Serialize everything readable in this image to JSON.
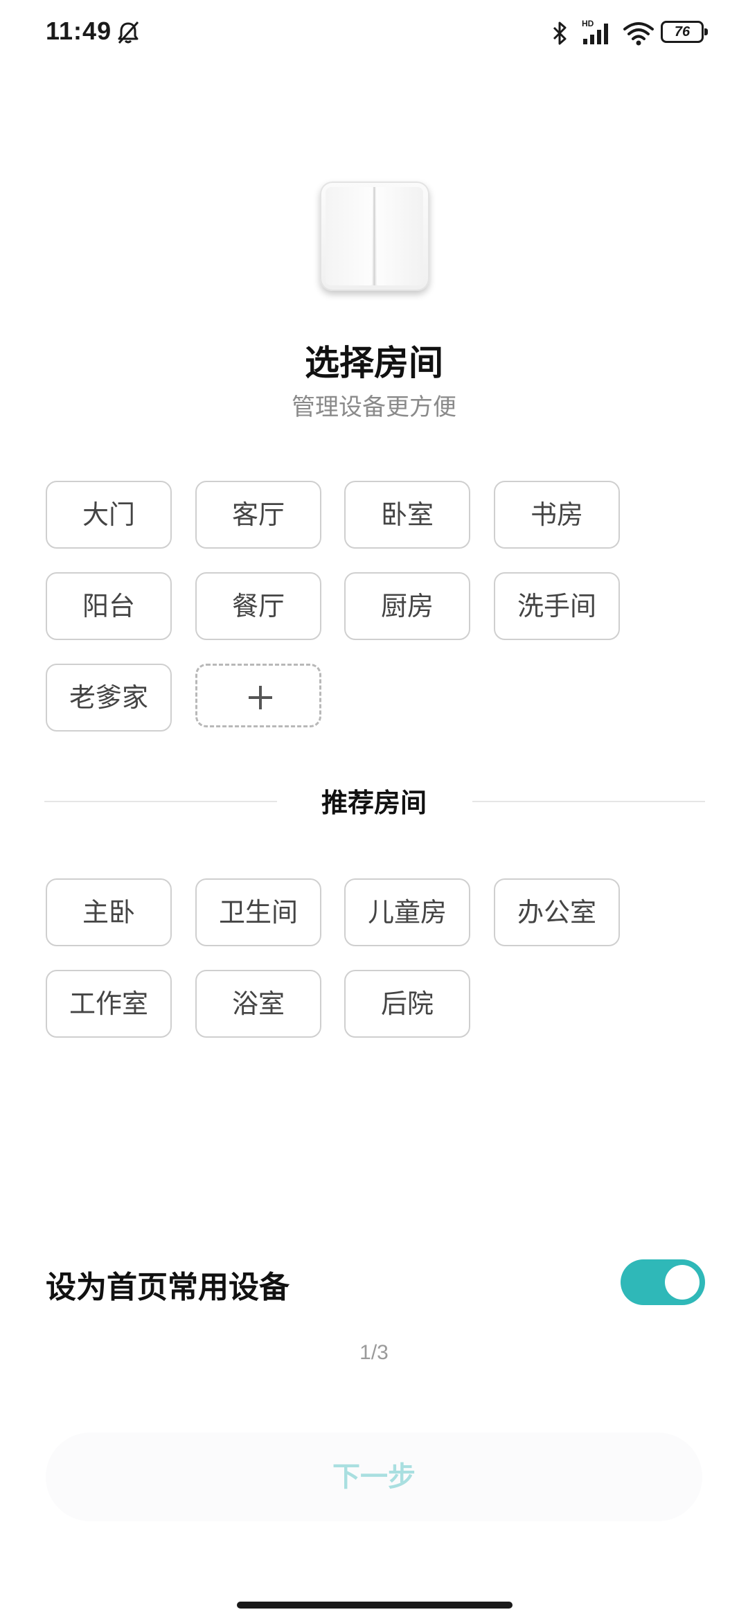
{
  "status_bar": {
    "time": "11:49",
    "network_badge": "HD",
    "battery_level": "76",
    "icons": [
      "bell-off-icon",
      "bluetooth-icon",
      "signal-icon",
      "wifi-icon",
      "battery-icon"
    ]
  },
  "header": {
    "device_icon": "double-rocker-switch-icon",
    "title": "选择房间",
    "subtitle": "管理设备更方便"
  },
  "rooms": {
    "items": [
      "大门",
      "客厅",
      "卧室",
      "书房",
      "阳台",
      "餐厅",
      "厨房",
      "洗手间",
      "老爹家"
    ],
    "add_icon": "plus-icon"
  },
  "recommended": {
    "title": "推荐房间",
    "items": [
      "主卧",
      "卫生间",
      "儿童房",
      "办公室",
      "工作室",
      "浴室",
      "后院"
    ]
  },
  "home_setting": {
    "label": "设为首页常用设备",
    "enabled": true,
    "accent_color": "#2fb8b8"
  },
  "pager": "1/3",
  "next_button": "下一步"
}
